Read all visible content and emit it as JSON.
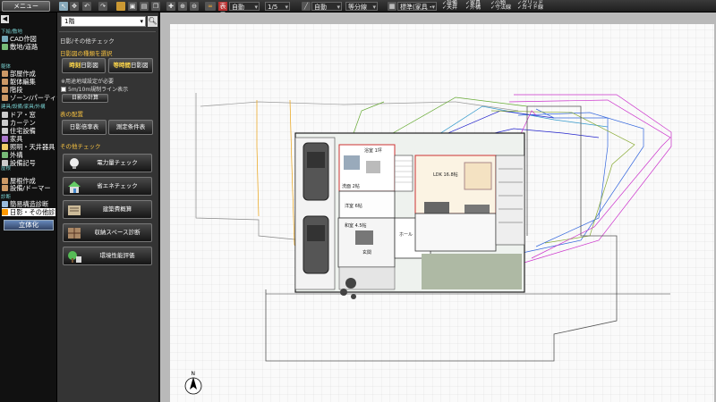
{
  "toolbar": {
    "menu_label": "メニュー",
    "display_label": "表示",
    "auto_label": "自動",
    "scale_label": "1/5",
    "auto2_label": "自動",
    "dims_label": "等分線",
    "layer_label": "標準(家具・設)",
    "checks": {
      "equip": "設備",
      "ceiling": "天井",
      "furniture": "家具",
      "exterior": "外構",
      "small": "小物",
      "dims": "寸法線",
      "grid": "グリッド",
      "guide": "ガイド線"
    }
  },
  "leftnav": {
    "groups": [
      {
        "label": "下絵/敷地"
      },
      {
        "label": "躯体"
      },
      {
        "label": "建具/設備/家具/外構"
      },
      {
        "label": "屋根"
      },
      {
        "label": "診断"
      }
    ],
    "items": [
      {
        "label": "CAD作図",
        "icon": "cad-icon",
        "color": "#7ab"
      },
      {
        "label": "敷地/道路",
        "icon": "site-icon",
        "color": "#7b7"
      },
      {
        "label": "部屋作成",
        "icon": "room-icon",
        "color": "#c96"
      },
      {
        "label": "躯体編集",
        "icon": "structure-icon",
        "color": "#c96"
      },
      {
        "label": "階段",
        "icon": "stairs-icon",
        "color": "#c96"
      },
      {
        "label": "ゾーン/パーティション",
        "icon": "zone-icon",
        "color": "#c96"
      },
      {
        "label": "ドア・窓",
        "icon": "door-icon",
        "color": "#ccc"
      },
      {
        "label": "カーテン",
        "icon": "curtain-icon",
        "color": "#ccc"
      },
      {
        "label": "住宅設備",
        "icon": "equipment-icon",
        "color": "#ccc"
      },
      {
        "label": "家具",
        "icon": "furniture-icon",
        "color": "#a7c"
      },
      {
        "label": "照明・天井器具",
        "icon": "light-icon",
        "color": "#ec6"
      },
      {
        "label": "外構",
        "icon": "exterior-icon",
        "color": "#7b7"
      },
      {
        "label": "設備記号",
        "icon": "symbol-icon",
        "color": "#ccc"
      },
      {
        "label": "屋根作成",
        "icon": "roof-icon",
        "color": "#c96"
      },
      {
        "label": "設備/ドーマー",
        "icon": "dormer-icon",
        "color": "#c96"
      },
      {
        "label": "簡易構造診断",
        "icon": "diagnosis-icon",
        "color": "#9bd"
      },
      {
        "label": "日影・その他診断",
        "icon": "shadow-icon",
        "color": "#f90"
      }
    ],
    "solid_button": "立体化"
  },
  "panel": {
    "floor": "1階",
    "title": "日影/その他チェック",
    "shadow_header": "日影図の種類を選択",
    "btn_time_a": "時刻",
    "btn_time_b": "日影図",
    "btn_iso_a": "等時間",
    "btn_iso_b": "日影図",
    "opt1": "用途地域設定が必要",
    "opt2": "5m/10m規制ライン表示",
    "btn_calc": "日影の計算",
    "layout_header": "表の配置",
    "btn_table": "日影倍率表",
    "btn_cond": "測定条件表",
    "other_header": "その他チェック",
    "big_buttons": [
      {
        "label": "電力量チェック",
        "icon": "power-bulb-icon"
      },
      {
        "label": "省エネチェック",
        "icon": "eco-house-icon"
      },
      {
        "label": "建築費概算",
        "icon": "cost-icon"
      },
      {
        "label": "収納スペース診断",
        "icon": "storage-icon"
      },
      {
        "label": "環境性能評価",
        "icon": "environment-icon"
      }
    ]
  },
  "plan": {
    "compass": "N",
    "rooms": [
      {
        "label": "LDK 16.8帖"
      },
      {
        "label": "洋室 6帖"
      },
      {
        "label": "和室 4.5帖"
      },
      {
        "label": "浴室 1坪"
      },
      {
        "label": "洗面 2帖"
      },
      {
        "label": "玄関"
      },
      {
        "label": "ホール"
      }
    ]
  }
}
